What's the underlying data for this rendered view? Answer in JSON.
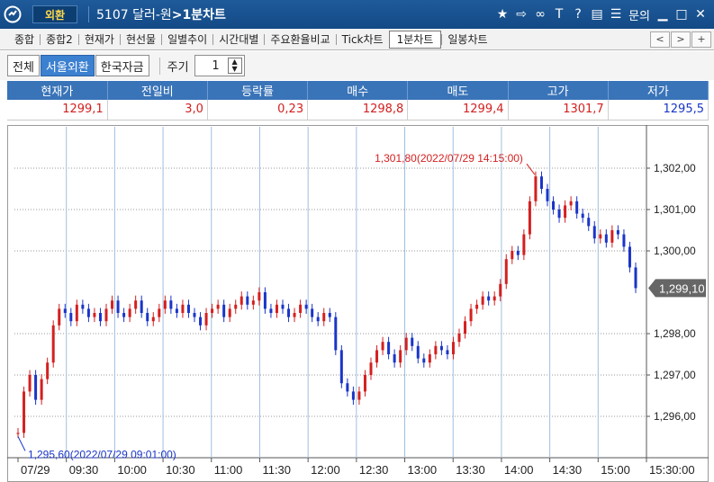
{
  "window": {
    "category": "외환",
    "title_code_name": "5107 달러-원",
    "title_suffix": ">1분차트",
    "toolbar_icons": [
      "star-icon",
      "export-icon",
      "link-icon",
      "font-icon",
      "help-icon",
      "print-icon",
      "list-icon"
    ],
    "inquiry_label": "문의",
    "minimize": "▁",
    "maximize": "□",
    "close": "✕"
  },
  "tabs": [
    "종합",
    "종합2",
    "현재가",
    "현선물",
    "일별추이",
    "시간대별",
    "주요환율비교",
    "Tick차트",
    "1분차트",
    "일봉차트"
  ],
  "active_tab": "1분차트",
  "tab_nav": {
    "prev": "<",
    "next": ">",
    "add": "+"
  },
  "options": {
    "buttons": [
      "전체",
      "서울외환",
      "한국자금"
    ],
    "selected": "서울외환",
    "period_label": "주기",
    "period_value": "1"
  },
  "quote": {
    "headers": [
      "현재가",
      "전일비",
      "등락률",
      "매수",
      "매도",
      "고가",
      "저가"
    ],
    "values": [
      "1299,1",
      "3,0",
      "0,23",
      "1298,8",
      "1299,4",
      "1301,7",
      "1295,5"
    ],
    "colors": [
      "#d42020",
      "#d42020",
      "#d42020",
      "#d42020",
      "#d42020",
      "#d42020",
      "#1a35c8"
    ]
  },
  "chart_data": {
    "type": "candlestick",
    "x_ticks": [
      "07/29",
      "09:30",
      "10:00",
      "10:30",
      "11:00",
      "11:30",
      "12:00",
      "12:30",
      "13:00",
      "13:30",
      "14:00",
      "14:30",
      "15:00",
      "15:30:00"
    ],
    "y_ticks": [
      "1,302,00",
      "1,301,00",
      "1,300,00",
      "1,298,00",
      "1,297,00",
      "1,296,00"
    ],
    "y_tick_values": [
      1302,
      1301,
      1300,
      1298,
      1297,
      1296
    ],
    "ylim": [
      1295.0,
      1303.0
    ],
    "grid": true,
    "up_color": "#d42020",
    "down_color": "#1a35c8",
    "current_price": {
      "value": 1299.1,
      "label": "1,299,10"
    },
    "high_annotation": {
      "value": 1301.8,
      "label": "1,301,80(2022/07/29 14:15:00)"
    },
    "low_annotation": {
      "value": 1295.6,
      "label": "1,295,60(2022/07/29 09:01:00)"
    },
    "series": [
      1295.6,
      1296.6,
      1297.0,
      1296.4,
      1296.9,
      1297.3,
      1298.2,
      1298.6,
      1298.5,
      1298.3,
      1298.7,
      1298.6,
      1298.4,
      1298.5,
      1298.3,
      1298.6,
      1298.8,
      1298.5,
      1298.4,
      1298.6,
      1298.8,
      1298.5,
      1298.3,
      1298.4,
      1298.6,
      1298.8,
      1298.6,
      1298.5,
      1298.7,
      1298.5,
      1298.4,
      1298.2,
      1298.5,
      1298.6,
      1298.7,
      1298.4,
      1298.6,
      1298.7,
      1298.9,
      1298.7,
      1298.8,
      1299.0,
      1298.6,
      1298.5,
      1298.7,
      1298.6,
      1298.4,
      1298.5,
      1298.7,
      1298.6,
      1298.4,
      1298.3,
      1298.5,
      1298.4,
      1297.6,
      1296.8,
      1296.6,
      1296.4,
      1296.6,
      1297.0,
      1297.3,
      1297.6,
      1297.8,
      1297.5,
      1297.3,
      1297.6,
      1297.9,
      1297.7,
      1297.4,
      1297.3,
      1297.5,
      1297.7,
      1297.6,
      1297.5,
      1297.8,
      1298.0,
      1298.3,
      1298.6,
      1298.7,
      1298.9,
      1298.8,
      1298.9,
      1299.2,
      1299.8,
      1300.0,
      1299.9,
      1300.4,
      1301.2,
      1301.8,
      1301.5,
      1301.2,
      1301.0,
      1300.8,
      1301.1,
      1301.2,
      1300.9,
      1300.8,
      1300.6,
      1300.3,
      1300.4,
      1300.2,
      1300.5,
      1300.4,
      1300.1,
      1299.6,
      1299.1
    ]
  }
}
